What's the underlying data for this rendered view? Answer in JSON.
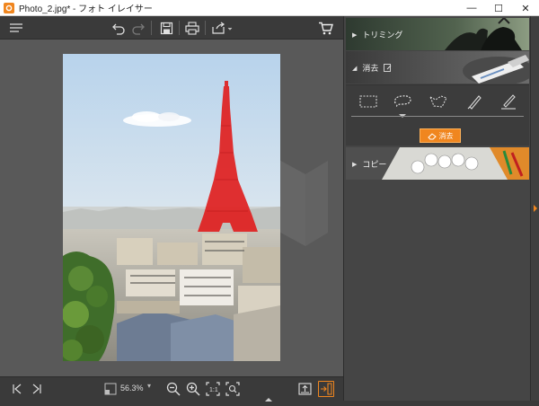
{
  "window": {
    "title": "Photo_2.jpg* - フォト イレイサー",
    "controls": {
      "minimize": "—",
      "maximize": "☐",
      "close": "✕"
    }
  },
  "toolbar": {
    "icons": [
      "menu-icon",
      "undo-icon",
      "redo-icon",
      "save-icon",
      "print-icon",
      "share-icon",
      "cart-icon"
    ]
  },
  "bottombar": {
    "zoom": "56.3%",
    "icons": [
      "first-page-icon",
      "last-page-icon",
      "zoom-out-icon",
      "zoom-in-icon",
      "fit-icon",
      "actual-size-icon",
      "export-icon",
      "compare-icon"
    ]
  },
  "panel": {
    "sections": [
      {
        "label": "トリミング",
        "expanded": false
      },
      {
        "label": "消去",
        "expanded": true
      },
      {
        "label": "コピー",
        "expanded": false
      }
    ],
    "tools": [
      "rectangle-select-icon",
      "lasso-icon",
      "polygon-lasso-icon",
      "brush-icon",
      "eraser-brush-icon"
    ],
    "selected_tool": 1,
    "erase_button": "消去"
  },
  "colors": {
    "accent": "#f0861f",
    "highlight": "#e02020",
    "panel_bg": "#454545",
    "canvas_bg": "#595959"
  }
}
